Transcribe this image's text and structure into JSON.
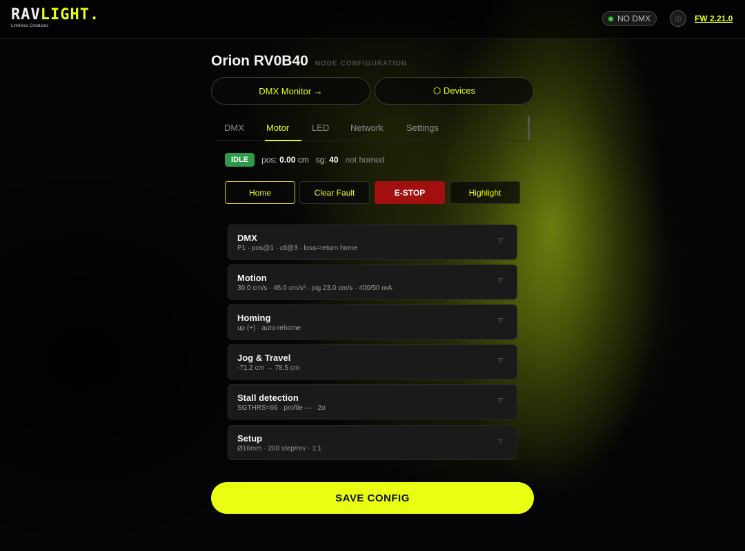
{
  "header": {
    "logo_part1": "RAV",
    "logo_part2": "LIGHT.",
    "tagline": "Limitless Creations",
    "dmx_status": "NO DMX",
    "info_icon": "info-icon",
    "firmware": "FW 2.21.0"
  },
  "page": {
    "title": "Orion RV0B40",
    "subtitle": "NODE CONFIGURATION"
  },
  "nav": {
    "dmx_monitor": "DMX Monitor →",
    "devices": "⬡ Devices"
  },
  "tabs": [
    {
      "label": "DMX"
    },
    {
      "label": "Motor"
    },
    {
      "label": "LED"
    },
    {
      "label": "Network"
    },
    {
      "label": "Settings"
    }
  ],
  "active_tab": "Motor",
  "status": {
    "badge": "IDLE",
    "pos_label": "pos:",
    "pos_value": "0.00",
    "pos_unit": "cm",
    "sg_label": "sg:",
    "sg_value": "40",
    "homed": "not homed"
  },
  "actions": {
    "home": "Home",
    "clear_fault": "Clear Fault",
    "estop": "E-STOP",
    "highlight": "Highlight"
  },
  "sections": [
    {
      "title": "DMX",
      "summary": "P1 · pos@1 · ctl@3 · loss=return home"
    },
    {
      "title": "Motion",
      "summary": "39.0 cm/s · 46.0 cm/s² · jog 23.0 cm/s · 400/50 mA"
    },
    {
      "title": "Homing",
      "summary": "up (+) · auto-rehome"
    },
    {
      "title": "Jog & Travel",
      "summary": "-71.2 cm → 78.5 cm"
    },
    {
      "title": "Stall detection",
      "summary": "SGTHRS=66 · profile — · 2σ"
    },
    {
      "title": "Setup",
      "summary": "Ø16mm · 200 step/rev · 1:1"
    }
  ],
  "chevron": "▽",
  "save_label": "SAVE CONFIG",
  "colors": {
    "accent": "#e8ff14",
    "danger": "#a10f0f",
    "ok": "#2e9a4a",
    "status_dot": "#2ecc40"
  }
}
